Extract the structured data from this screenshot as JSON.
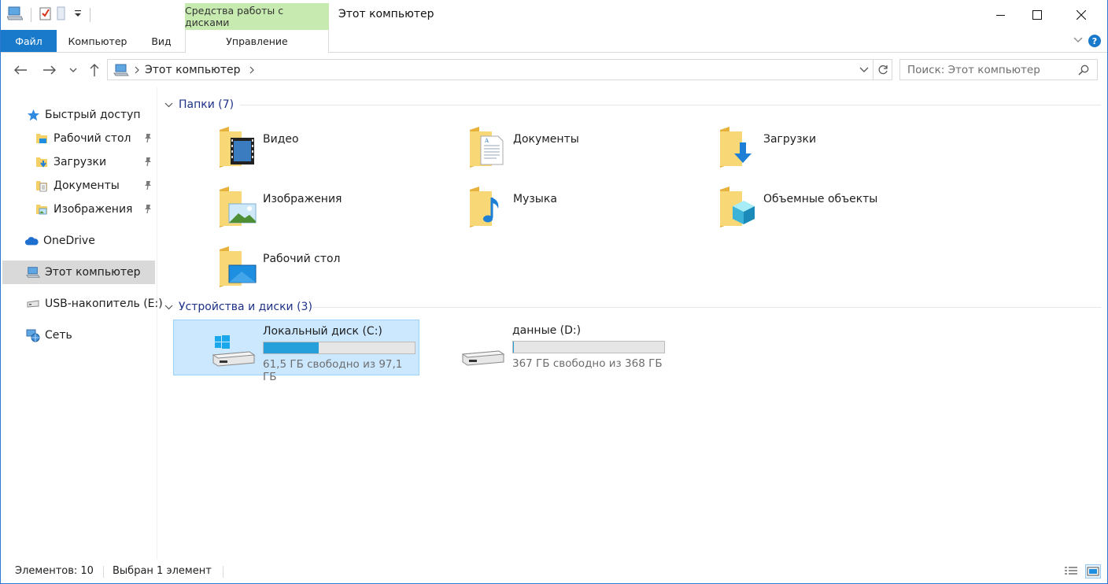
{
  "titlebar": {
    "title": "Этот компьютер",
    "contextual_tab": "Средства работы с дисками",
    "qat_icons": [
      "computer-icon",
      "properties-icon",
      "new-folder-icon",
      "customize-dropdown-icon"
    ]
  },
  "ribbon": {
    "tabs": [
      {
        "label": "Файл"
      },
      {
        "label": "Компьютер"
      },
      {
        "label": "Вид"
      },
      {
        "label": "Управление"
      }
    ]
  },
  "address": {
    "path": "Этот компьютер",
    "search_placeholder": "Поиск: Этот компьютер"
  },
  "sidebar": {
    "quick_access": "Быстрый доступ",
    "pinned": [
      {
        "label": "Рабочий стол"
      },
      {
        "label": "Загрузки"
      },
      {
        "label": "Документы"
      },
      {
        "label": "Изображения"
      }
    ],
    "onedrive": "OneDrive",
    "this_pc": "Этот компьютер",
    "usb": "USB-накопитель (E:)",
    "network": "Сеть"
  },
  "content": {
    "folders_header": "Папки (7)",
    "folders": [
      {
        "name": "Видео",
        "overlay": "video"
      },
      {
        "name": "Документы",
        "overlay": "document"
      },
      {
        "name": "Загрузки",
        "overlay": "download"
      },
      {
        "name": "Изображения",
        "overlay": "picture"
      },
      {
        "name": "Музыка",
        "overlay": "music"
      },
      {
        "name": "Объемные объекты",
        "overlay": "cube"
      },
      {
        "name": "Рабочий стол",
        "overlay": "desktop"
      }
    ],
    "drives_header": "Устройства и диски (3)",
    "drives": [
      {
        "name": "Локальный диск (C:)",
        "free": "61,5 ГБ свободно из 97,1 ГБ",
        "used_fraction": 0.367,
        "selected": true,
        "system": true
      },
      {
        "name": "данные (D:)",
        "free": "367 ГБ свободно из 368 ГБ",
        "used_fraction": 0.003,
        "selected": false,
        "system": false
      }
    ]
  },
  "status": {
    "items": "Элементов: 10",
    "selected": "Выбран 1 элемент"
  },
  "colors": {
    "accent": "#1979ca",
    "selection_bg": "#cce8ff",
    "selection_border": "#99d1ff",
    "drive_fill": "#26a0da",
    "group_header": "#1e3287",
    "contextual_tab_bg": "#c6eab0"
  }
}
